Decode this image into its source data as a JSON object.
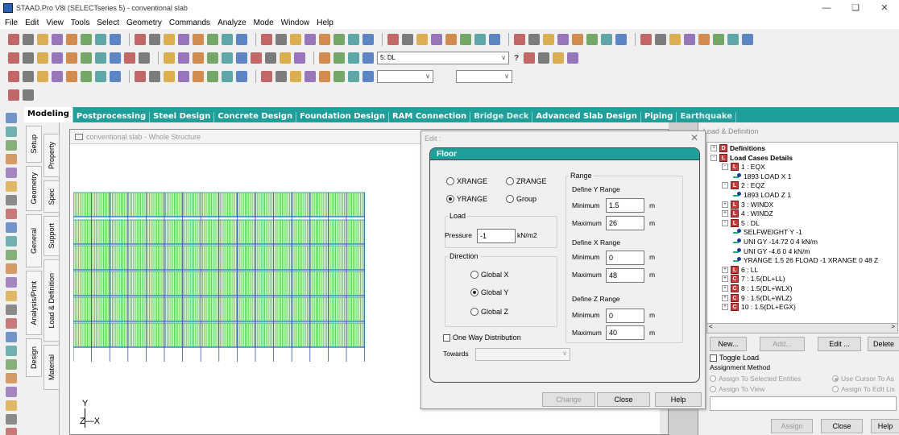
{
  "window": {
    "title": "STAAD.Pro V8i (SELECTseries 5) - conventional slab",
    "controls": {
      "minimize": "—",
      "restore": "❏",
      "close": "✕"
    }
  },
  "menu": [
    "File",
    "Edit",
    "View",
    "Tools",
    "Select",
    "Geometry",
    "Commands",
    "Analyze",
    "Mode",
    "Window",
    "Help"
  ],
  "toolbar": {
    "load_case_combo": "5: DL",
    "help_glyph": "?"
  },
  "mode_tabs": [
    {
      "label": "Modeling",
      "state": "active"
    },
    {
      "label": "Postprocessing",
      "state": "normal"
    },
    {
      "label": "Steel Design",
      "state": "normal"
    },
    {
      "label": "Concrete Design",
      "state": "normal"
    },
    {
      "label": "Foundation Design",
      "state": "normal"
    },
    {
      "label": "RAM Connection",
      "state": "normal"
    },
    {
      "label": "Bridge Deck",
      "state": "dim"
    },
    {
      "label": "Advanced Slab Design",
      "state": "normal"
    },
    {
      "label": "Piping",
      "state": "normal"
    },
    {
      "label": "Earthquake",
      "state": "dim"
    }
  ],
  "page_tabs": {
    "outer": [
      "Setup",
      "Geometry",
      "General",
      "Analysis/Print",
      "Design"
    ],
    "inner": [
      "Property",
      "Spec",
      "Support",
      "Load & Definition",
      "Material"
    ]
  },
  "view": {
    "title": "conventional slab - Whole Structure",
    "axis": {
      "y": "Y",
      "zx": "Z—X"
    }
  },
  "dialog": {
    "title": "Edit :",
    "close": "✕",
    "section": "Floor",
    "range_options": [
      "XRANGE",
      "ZRANGE",
      "YRANGE",
      "Group"
    ],
    "selected_range": "YRANGE",
    "load_group_label": "Load",
    "pressure_label": "Pressure",
    "pressure_value": "-1",
    "pressure_unit": "kN/m2",
    "direction_label": "Direction",
    "directions": [
      "Global X",
      "Global Y",
      "Global Z"
    ],
    "selected_direction": "Global Y",
    "one_way_label": "One Way Distribution",
    "one_way_checked": false,
    "towards_label": "Towards",
    "range_group_label": "Range",
    "define_y": {
      "label": "Define Y Range",
      "min": "1.5",
      "max": "26"
    },
    "define_x": {
      "label": "Define X Range",
      "min": "0",
      "max": "48"
    },
    "define_z": {
      "label": "Define Z Range",
      "min": "0",
      "max": "40"
    },
    "min_label": "Minimum",
    "max_label": "Maximum",
    "unit": "m",
    "buttons": {
      "change": "Change",
      "close": "Close",
      "help": "Help"
    }
  },
  "panel": {
    "title": "Load & Definition",
    "tree": [
      {
        "text": "Definitions",
        "icon": "D",
        "level": 0,
        "bold": true,
        "toggle": "+"
      },
      {
        "text": "Load Cases Details",
        "icon": "L",
        "level": 0,
        "bold": true,
        "toggle": "-"
      },
      {
        "text": "1 : EQX",
        "icon": "L",
        "level": 1,
        "toggle": "-"
      },
      {
        "text": "1893 LOAD X 1",
        "icon": "load",
        "level": 2
      },
      {
        "text": "2 : EQZ",
        "icon": "L",
        "level": 1,
        "toggle": "-"
      },
      {
        "text": "1893 LOAD Z 1",
        "icon": "load",
        "level": 2
      },
      {
        "text": "3 : WINDX",
        "icon": "L",
        "level": 1,
        "toggle": "+"
      },
      {
        "text": "4 : WINDZ",
        "icon": "L",
        "level": 1,
        "toggle": "+"
      },
      {
        "text": "5 : DL",
        "icon": "L",
        "level": 1,
        "toggle": "-"
      },
      {
        "text": "SELFWEIGHT Y -1",
        "icon": "load",
        "level": 2
      },
      {
        "text": "UNI GY -14.72 0 4 kN/m",
        "icon": "load",
        "level": 2
      },
      {
        "text": "UNI GY -4.6 0 4 kN/m",
        "icon": "load",
        "level": 2
      },
      {
        "text": "YRANGE 1.5 26 FLOAD -1 XRANGE 0 48 Z",
        "icon": "load",
        "level": 2
      },
      {
        "text": "6 : LL",
        "icon": "L",
        "level": 1,
        "toggle": "+"
      },
      {
        "text": "7 : 1.5(DL+LL)",
        "icon": "C",
        "level": 1,
        "toggle": "+"
      },
      {
        "text": "8 : 1.5(DL+WLX)",
        "icon": "C",
        "level": 1,
        "toggle": "+"
      },
      {
        "text": "9 : 1.5(DL+WLZ)",
        "icon": "C",
        "level": 1,
        "toggle": "+"
      },
      {
        "text": "10 : 1.5(DL+EGX)",
        "icon": "C",
        "level": 1,
        "toggle": "+"
      }
    ],
    "scroll_left": "<",
    "scroll_right": ">",
    "buttons": {
      "new": "New...",
      "add": "Add...",
      "edit": "Edit ...",
      "delete": "Delete"
    },
    "toggle_load": "Toggle Load",
    "assignment_method": "Assignment Method",
    "assign_selected": "Assign To Selected Entities",
    "assign_view": "Assign To View",
    "use_cursor": "Use Cursor To As",
    "assign_edit_list": "Assign To Edit Lis",
    "assign_button": "Assign",
    "close_button": "Close",
    "help_button": "Help"
  }
}
